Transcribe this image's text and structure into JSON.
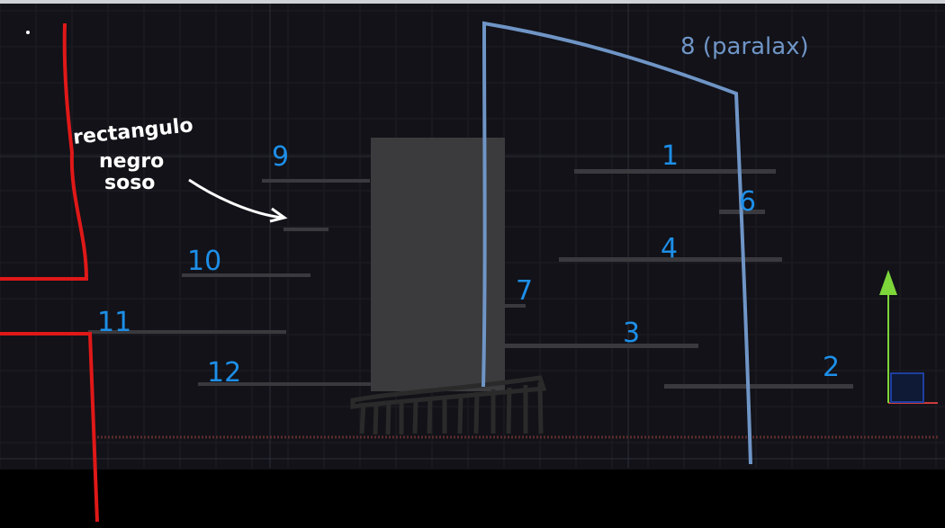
{
  "annotations": {
    "note_line1": "rectangulo",
    "note_line2": "negro",
    "note_line3": "soso",
    "parallax_label": "8 (paralax)"
  },
  "platform_numbers": [
    "1",
    "2",
    "3",
    "4",
    "6",
    "7",
    "9",
    "10",
    "11",
    "12"
  ],
  "colors": {
    "scene_background": "#121218",
    "grid_minor": "#1d1d24",
    "grid_major": "#2f2f38",
    "platform": "#3a3a3e",
    "annotation_blue": "#1d8fe8",
    "annotation_white": "#ffffff",
    "parallax_outline": "#6f95c6",
    "camera_bounds": "#e01818",
    "gizmo_y_axis": "#7dd63a",
    "gizmo_x_axis": "#cc3a3a",
    "gizmo_plane": "#1f3fa0",
    "ground_line": "#5a2c2c"
  },
  "icons": [
    "move-gizmo-icon"
  ]
}
